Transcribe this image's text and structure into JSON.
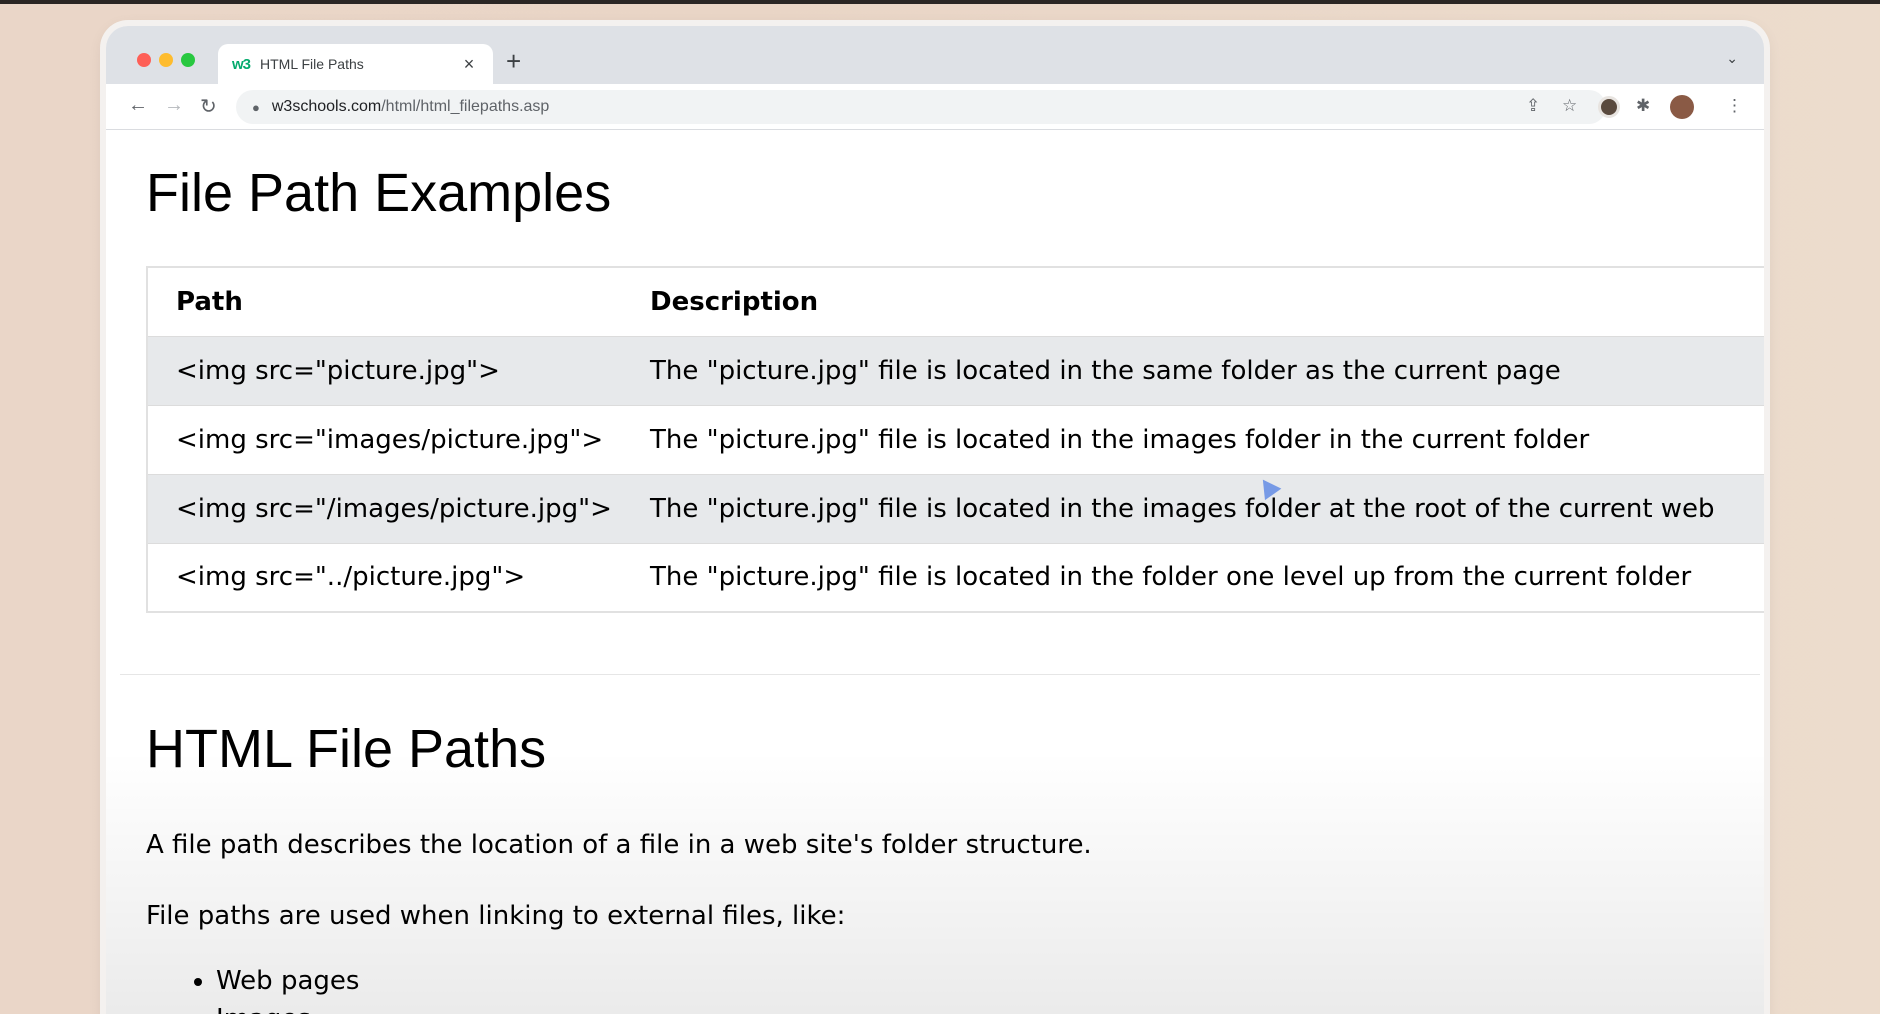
{
  "browser": {
    "tab": {
      "title": "HTML File Paths",
      "favicon": "w3",
      "close": "×"
    },
    "new_tab": "+",
    "tab_menu_icon": "chevron-down-icon",
    "url_host": "w3schools.com",
    "url_path": "/html/html_filepaths.asp",
    "icons": {
      "back": "←",
      "forward": "→",
      "reload": "↻",
      "lock": "🔒",
      "share": "⇪",
      "star": "☆",
      "puzzle": "✱",
      "kebab": "⋮",
      "chevron": "⌄"
    }
  },
  "page": {
    "section1_title": "File Path Examples",
    "table": {
      "headers": [
        "Path",
        "Description"
      ],
      "rows": [
        {
          "path": "<img src=\"picture.jpg\">",
          "description": "The \"picture.jpg\" file is located in the same folder as the current page"
        },
        {
          "path": "<img src=\"images/picture.jpg\">",
          "description": "The \"picture.jpg\" file is located in the images folder in the current folder"
        },
        {
          "path": "<img src=\"/images/picture.jpg\">",
          "description": "The \"picture.jpg\" file is located in the images folder at the root of the current web"
        },
        {
          "path": "<img src=\"../picture.jpg\">",
          "description": "The \"picture.jpg\" file is located in the folder one level up from the current folder"
        }
      ]
    },
    "section2_title": "HTML File Paths",
    "paragraph1": "A file path describes the location of a file in a web site's folder structure.",
    "paragraph2": "File paths are used when linking to external files, like:",
    "list": [
      "Web pages",
      "Images"
    ]
  }
}
